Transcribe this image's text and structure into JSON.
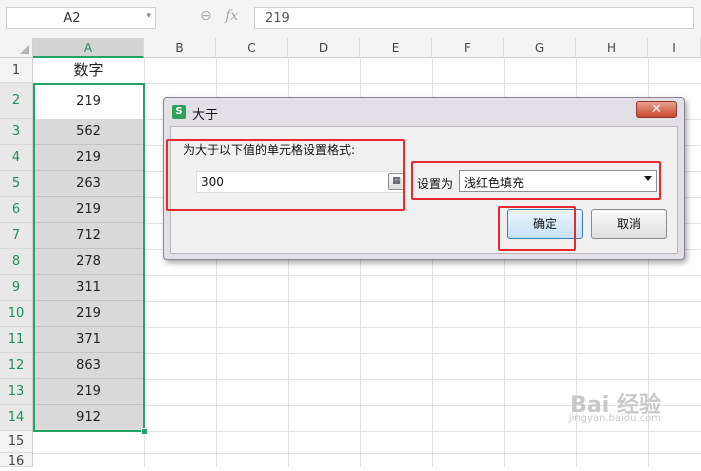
{
  "formula_bar": {
    "name_box": "A2",
    "cancel_icon": "zoom-icon",
    "fx_label": "fx",
    "formula_value": "219"
  },
  "columns": [
    "A",
    "B",
    "C",
    "D",
    "E",
    "F",
    "G",
    "H",
    "I"
  ],
  "rows": [
    "1",
    "2",
    "3",
    "4",
    "5",
    "6",
    "7",
    "8",
    "9",
    "10",
    "11",
    "12",
    "13",
    "14",
    "15",
    "16"
  ],
  "column_a": {
    "header": "数字",
    "values": [
      "219",
      "562",
      "219",
      "263",
      "219",
      "712",
      "278",
      "311",
      "219",
      "371",
      "863",
      "219",
      "912"
    ]
  },
  "dialog": {
    "title": "大于",
    "app_icon_letter": "S",
    "close_label": "✕",
    "instruction": "为大于以下值的单元格设置格式:",
    "value": "300",
    "set_as_label": "设置为",
    "format_option": "浅红色填充",
    "ok_label": "确定",
    "cancel_label": "取消"
  },
  "colors": {
    "selection_green": "#21a366",
    "annotation_red": "#e52b2b",
    "shaded_cell": "#d9d9d9"
  },
  "watermark": {
    "brand": "Bai 经验",
    "url": "jingyan.baidu.com"
  }
}
